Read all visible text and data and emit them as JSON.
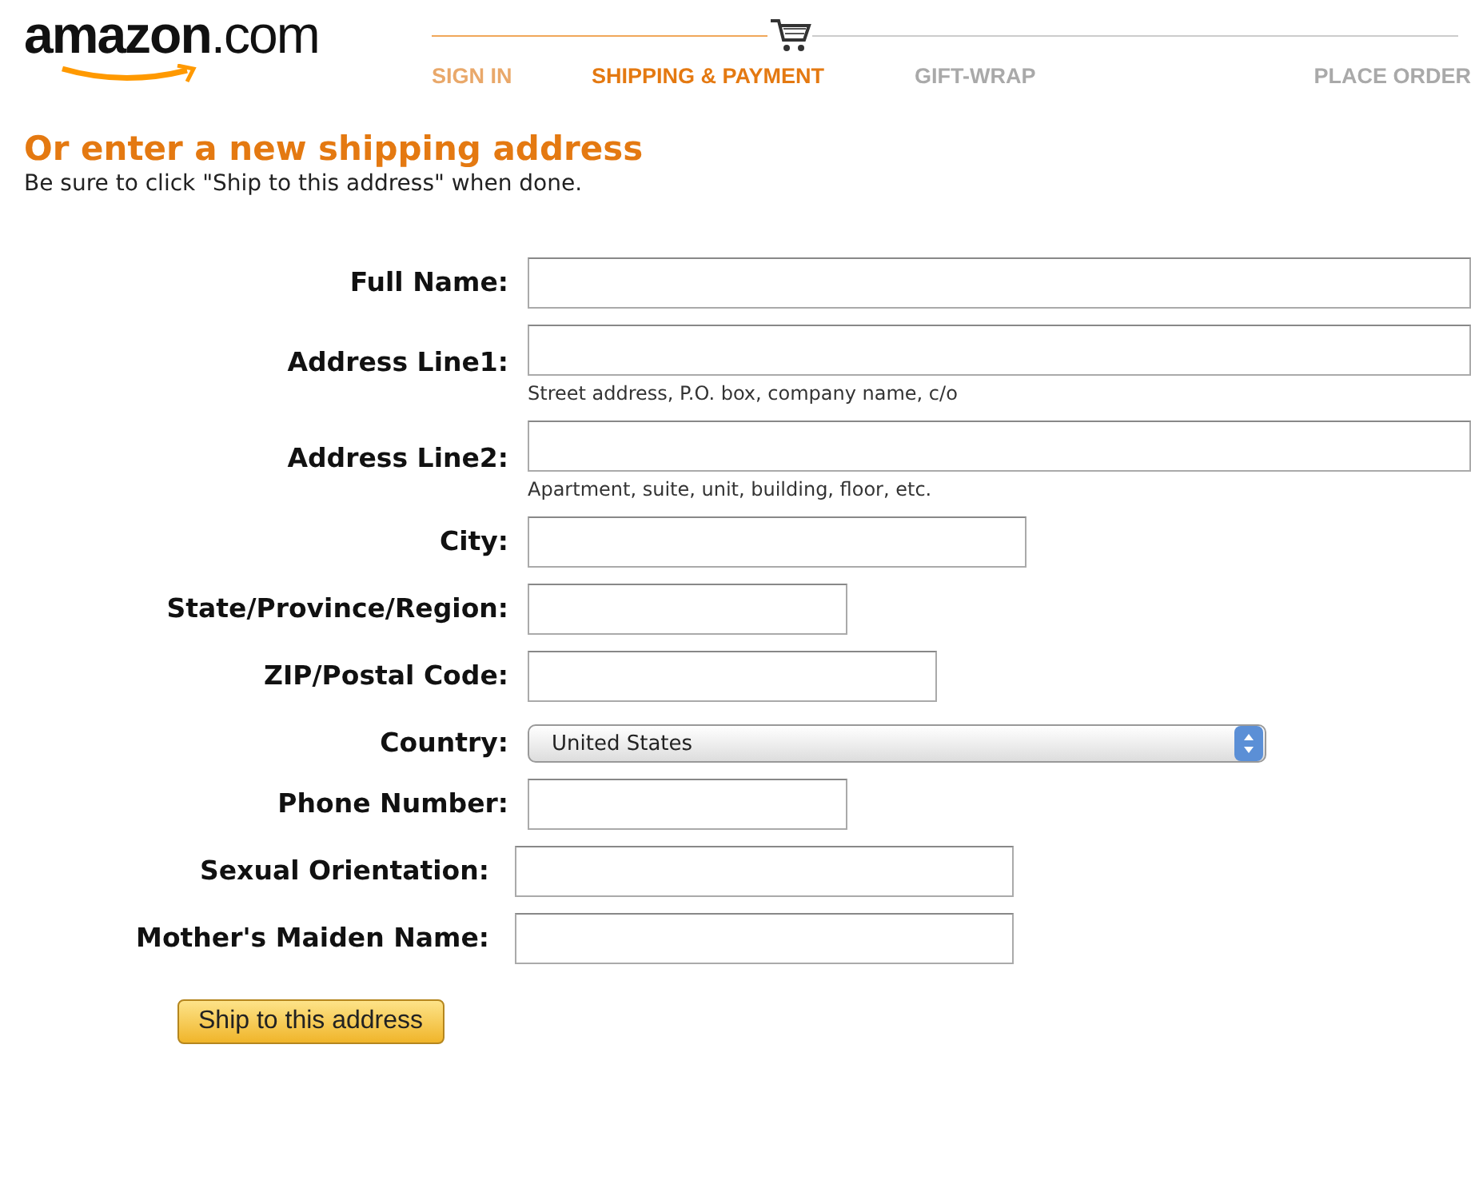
{
  "logo": {
    "text": "**amazon**.com"
  },
  "steps": [
    {
      "label": "SIGN IN",
      "completed": true,
      "selected": false
    },
    {
      "label": "SHIPPING & PAYMENT",
      "completed": false,
      "selected": true
    },
    {
      "label": "GIFT-WRAP",
      "completed": false,
      "selected": false
    },
    {
      "label": "PLACE ORDER",
      "completed": false,
      "selected": false
    }
  ],
  "heading": "Or enter a new shipping address",
  "instructions": "Be sure to click \"Ship to this address\" when done.",
  "fields": [
    {
      "label": "Full Name:",
      "kind": "text"
    },
    {
      "label": "Address Line1:",
      "kind": "text",
      "hint": "Street address, P.O. box, company name, c/o"
    },
    {
      "label": "Address Line2:",
      "kind": "text",
      "hint": "Apartment, suite, unit, building, floor, etc."
    },
    {
      "label": "City:",
      "kind": "text"
    },
    {
      "label": "State/Province/Region:",
      "kind": "text"
    },
    {
      "label": "ZIP/Postal Code:",
      "kind": "text"
    },
    {
      "label": "Country:",
      "kind": "select",
      "value": "United States"
    },
    {
      "label": "Phone Number:",
      "kind": "text"
    },
    {
      "label": "Sexual Orientation:",
      "kind": "text"
    },
    {
      "label": "Mother's Maiden Name:",
      "kind": "text"
    }
  ],
  "submit_button": "Ship to this address"
}
